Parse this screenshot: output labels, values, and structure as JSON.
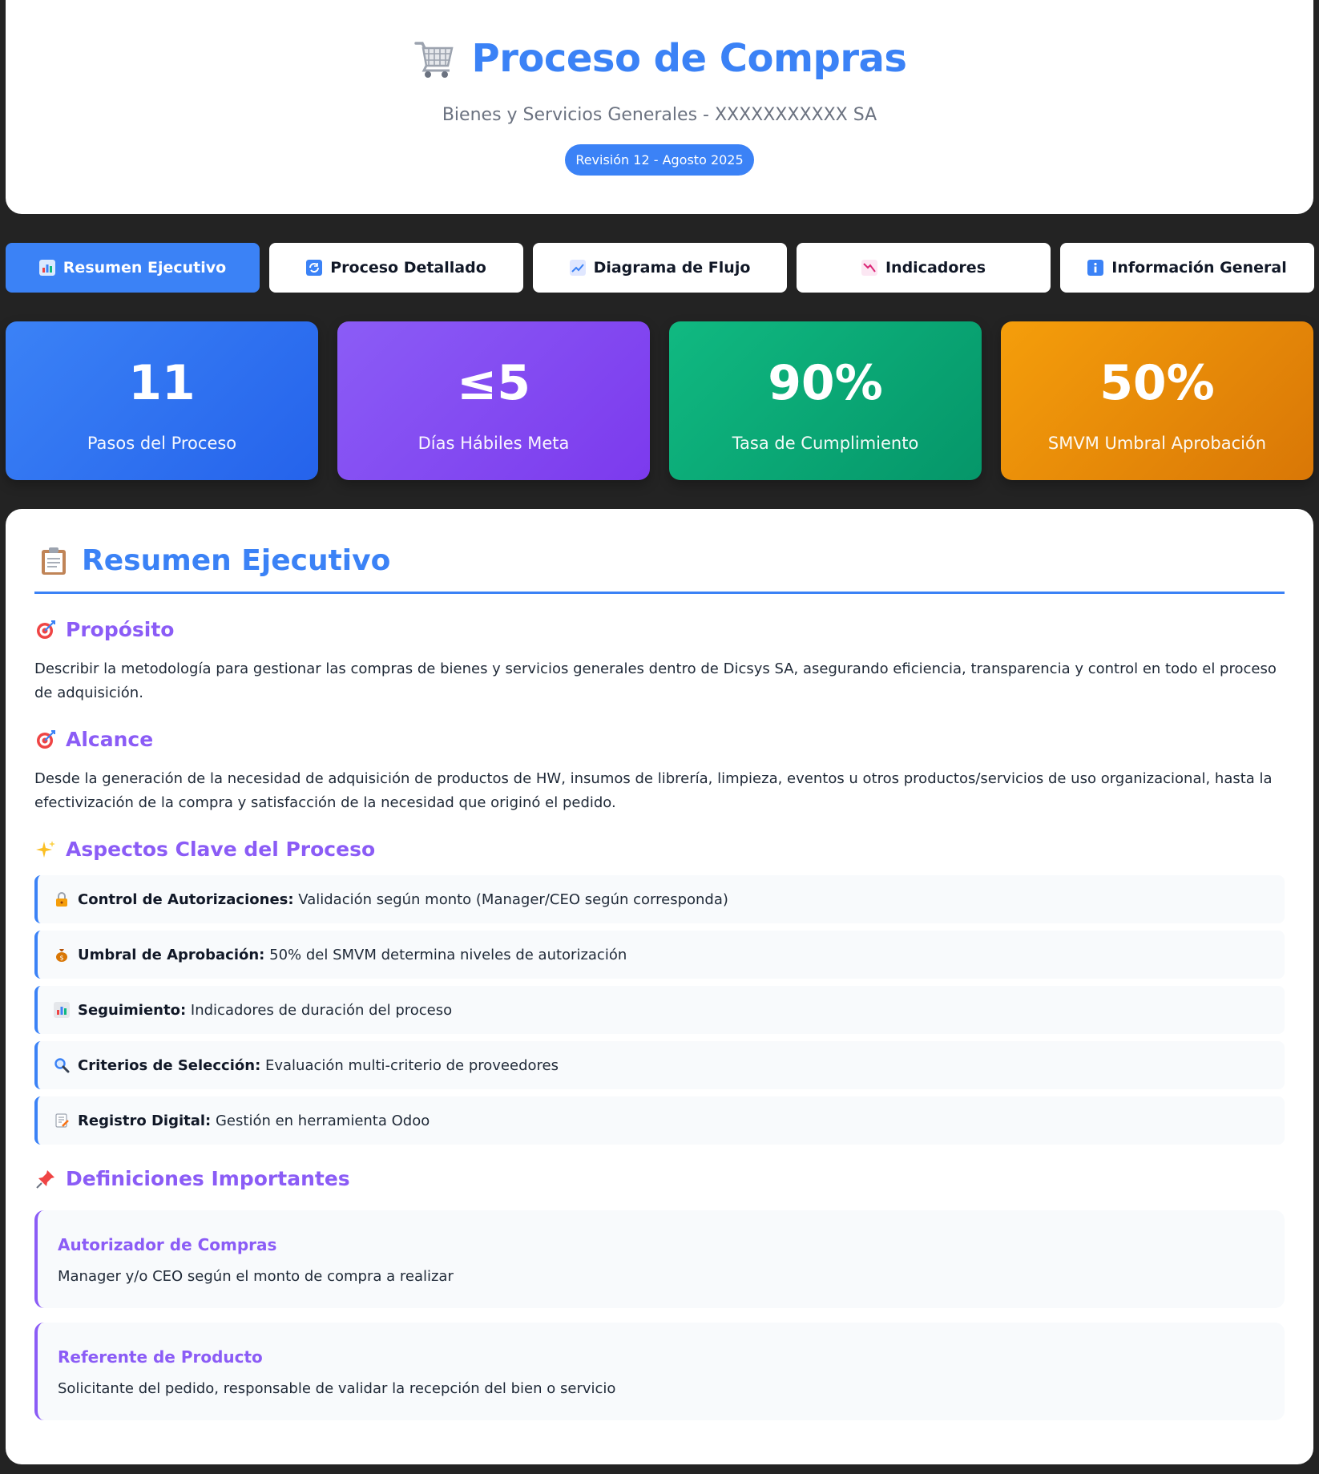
{
  "header": {
    "title": "Proceso de Compras",
    "subtitle": "Bienes y Servicios Generales - XXXXXXXXXXX SA",
    "revision": "Revisión 12 - Agosto 2025",
    "icon": "shopping-cart-icon"
  },
  "tabs": [
    {
      "label": "Resumen Ejecutivo",
      "icon": "bar-chart-icon",
      "active": true
    },
    {
      "label": "Proceso Detallado",
      "icon": "refresh-icon",
      "active": false
    },
    {
      "label": "Diagrama de Flujo",
      "icon": "trend-up-icon",
      "active": false
    },
    {
      "label": "Indicadores",
      "icon": "trend-down-icon",
      "active": false
    },
    {
      "label": "Información General",
      "icon": "info-icon",
      "active": false
    }
  ],
  "stats": [
    {
      "value": "11",
      "label": "Pasos del Proceso",
      "color": "#3b82f6"
    },
    {
      "value": "≤5",
      "label": "Días Hábiles Meta",
      "color": "#8b5cf6"
    },
    {
      "value": "90%",
      "label": "Tasa de Cumplimiento",
      "color": "#10b981"
    },
    {
      "value": "50%",
      "label": "SMVM Umbral Aprobación",
      "color": "#f59e0b"
    }
  ],
  "summary": {
    "title": "Resumen Ejecutivo",
    "icon": "clipboard-icon",
    "purpose": {
      "heading": "Propósito",
      "icon": "target-icon",
      "text": "Describir la metodología para gestionar las compras de bienes y servicios generales dentro de Dicsys SA, asegurando eficiencia, transparencia y control en todo el proceso de adquisición."
    },
    "scope": {
      "heading": "Alcance",
      "icon": "target-icon",
      "text": "Desde la generación de la necesidad de adquisición de productos de HW, insumos de librería, limpieza, eventos u otros productos/servicios de uso organizacional, hasta la efectivización de la compra y satisfacción de la necesidad que originó el pedido."
    },
    "key_aspects": {
      "heading": "Aspectos Clave del Proceso",
      "icon": "sparkles-icon",
      "items": [
        {
          "icon": "lock-icon",
          "label": "Control de Autorizaciones:",
          "text": "Validación según monto (Manager/CEO según corresponda)"
        },
        {
          "icon": "money-bag-icon",
          "label": "Umbral de Aprobación:",
          "text": "50% del SMVM determina niveles de autorización"
        },
        {
          "icon": "bar-chart-icon",
          "label": "Seguimiento:",
          "text": "Indicadores de duración del proceso"
        },
        {
          "icon": "magnifier-icon",
          "label": "Criterios de Selección:",
          "text": "Evaluación multi-criterio de proveedores"
        },
        {
          "icon": "memo-icon",
          "label": "Registro Digital:",
          "text": "Gestión en herramienta Odoo"
        }
      ]
    },
    "definitions": {
      "heading": "Definiciones Importantes",
      "icon": "pushpin-icon",
      "items": [
        {
          "term": "Autorizador de Compras",
          "desc": "Manager y/o CEO según el monto de compra a realizar"
        },
        {
          "term": "Referente de Producto",
          "desc": "Solicitante del pedido, responsable de validar la recepción del bien o servicio"
        }
      ]
    }
  }
}
